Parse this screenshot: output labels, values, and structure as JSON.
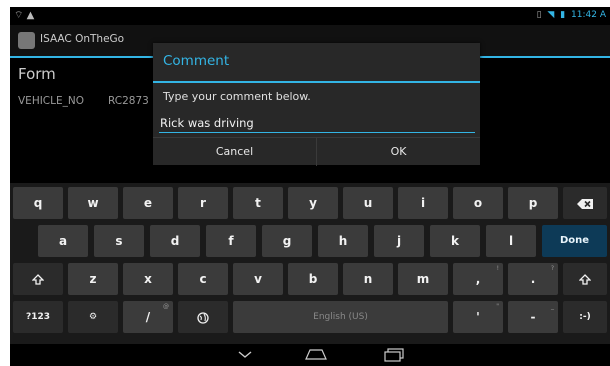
{
  "status_bar": {
    "left_icons": [
      "notification-icon",
      "warning-icon"
    ],
    "right_icons": [
      "sim-icon",
      "wifi-icon",
      "battery-icon"
    ],
    "time": "11:42 A"
  },
  "app": {
    "title": "ISAAC OnTheGo",
    "logo_icon": "app-logo-icon"
  },
  "form": {
    "title": "Form",
    "field_label": "VEHICLE_NO",
    "field_value": "RC2873"
  },
  "dialog": {
    "title": "Comment",
    "message": "Type your comment below.",
    "input_value": "Rick was driving",
    "cancel_label": "Cancel",
    "ok_label": "OK",
    "accent_color": "#33b5e5"
  },
  "keyboard": {
    "row1": [
      "q",
      "w",
      "e",
      "r",
      "t",
      "y",
      "u",
      "i",
      "o",
      "p"
    ],
    "row2": [
      "a",
      "s",
      "d",
      "f",
      "g",
      "h",
      "j",
      "k",
      "l"
    ],
    "row3": [
      "z",
      "x",
      "c",
      "v",
      "b",
      "n",
      "m",
      ",",
      "."
    ],
    "done_label": "Done",
    "symbols_label": "?123",
    "settings_label": "⚙",
    "slash_label": "/",
    "slash_hint": "@",
    "space_label": "English (US)",
    "apostrophe_label": "'",
    "apostrophe_hint": "\"",
    "dash_label": "-",
    "dash_hint": "_",
    "smiley_label": ":-)",
    "comma_hint": "!",
    "period_hint": "?",
    "backspace_icon": "backspace-icon",
    "shift_icon": "shift-icon",
    "globe_icon": "globe-icon",
    "done_color": "#0d3a57"
  },
  "nav_bar": {
    "icons": [
      "back-chevron-icon",
      "home-icon",
      "recent-apps-icon"
    ]
  }
}
